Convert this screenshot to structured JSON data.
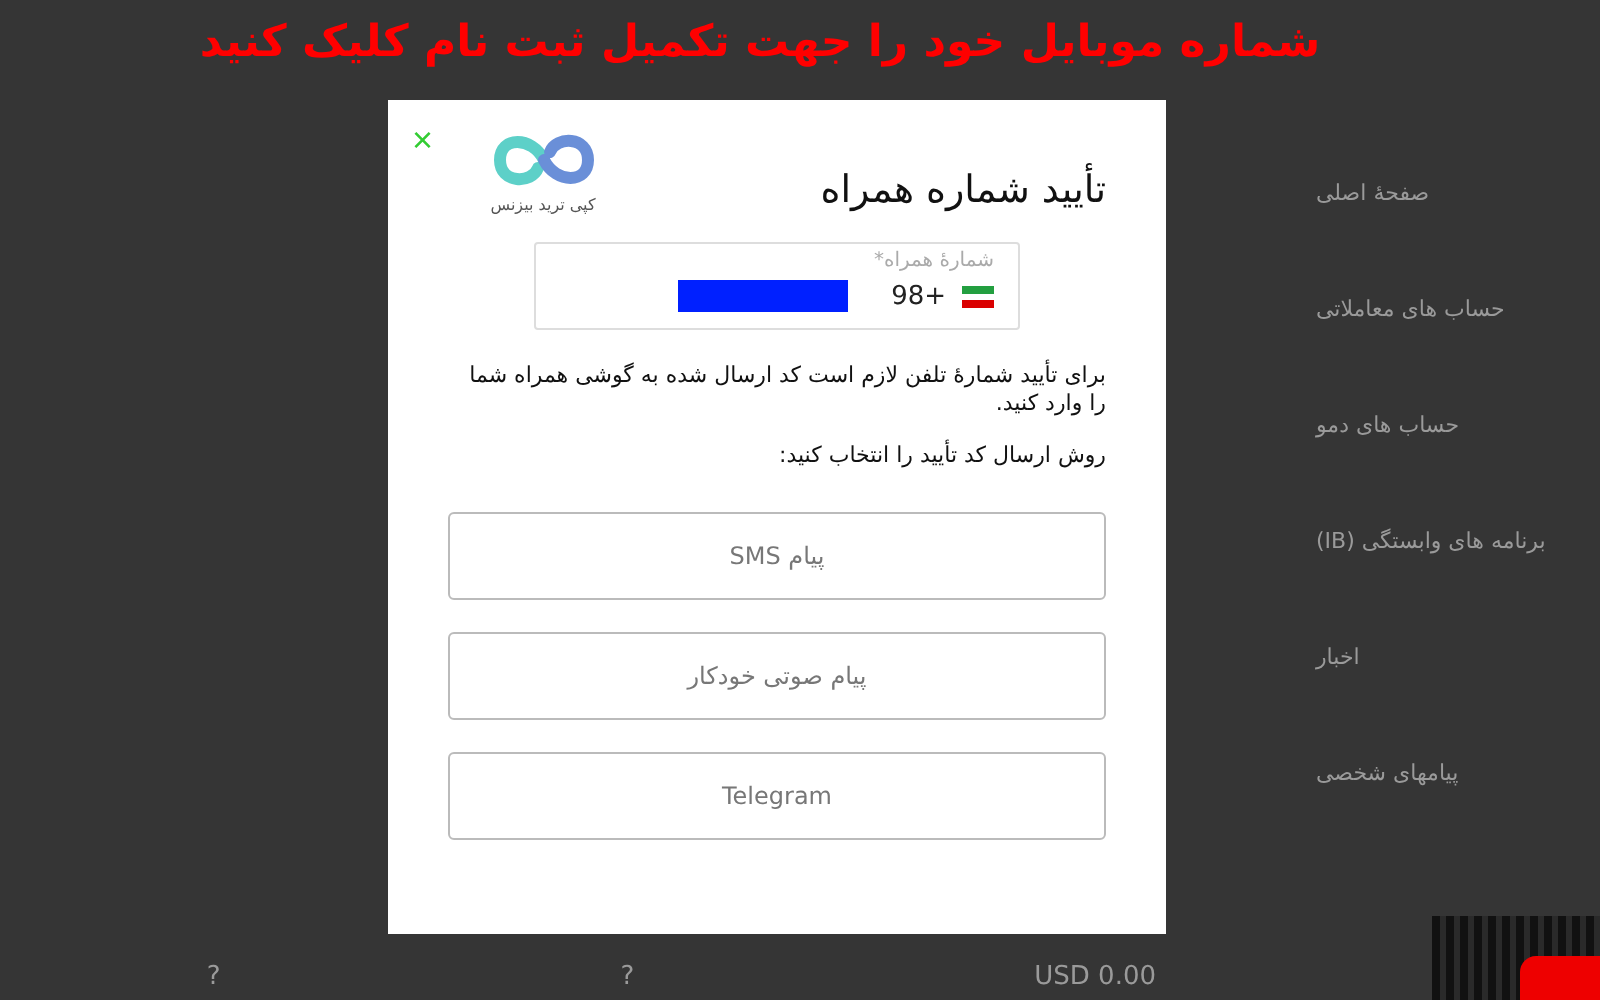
{
  "banner": {
    "text": "شماره موبایل خود را جهت تکمیل ثبت نام کلیک کنید"
  },
  "sidebar": {
    "items": [
      {
        "label": "صفحهٔ اصلی"
      },
      {
        "label": "حساب های معاملاتی"
      },
      {
        "label": "حساب های دمو"
      },
      {
        "label": "برنامه های وابستگی (IB)"
      },
      {
        "label": "اخبار"
      },
      {
        "label": "پیامهای شخصی"
      }
    ]
  },
  "footer": {
    "balance": "USD 0.00",
    "help_marks": [
      "?",
      "?"
    ]
  },
  "modal": {
    "close": "×",
    "logo_caption": "کپی ترید بیزنس",
    "title": "تأیید شماره همراه",
    "phone_field": {
      "label": "شمارهٔ همراه*",
      "country_code": "98+"
    },
    "instructions": "برای تأیید شمارهٔ تلفن لازم است کد ارسال شده به گوشی همراه شما را وارد کنید.",
    "method_prompt": "روش ارسال کد تأیید را انتخاب کنید:",
    "methods": [
      {
        "label": "پیام SMS"
      },
      {
        "label": "پیام صوتی خودکار"
      },
      {
        "label": "Telegram"
      }
    ]
  }
}
